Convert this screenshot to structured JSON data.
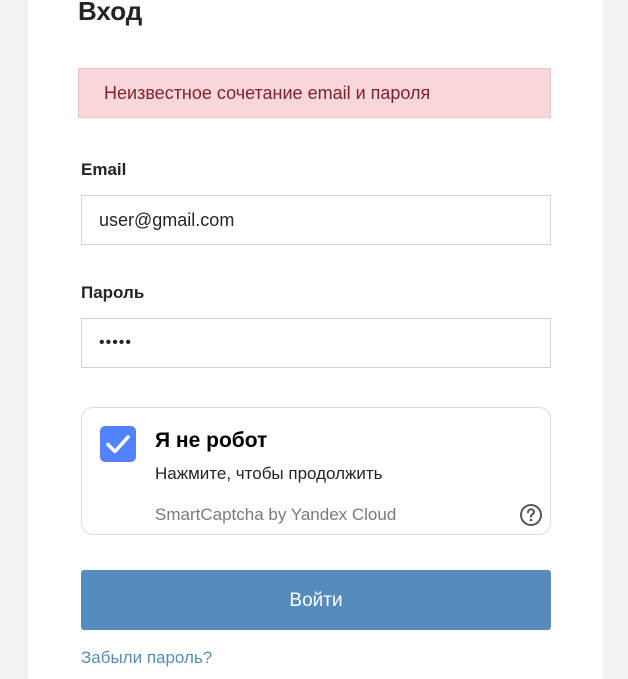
{
  "page": {
    "title": "Вход"
  },
  "alert": {
    "message": "Неизвестное сочетание email и пароля"
  },
  "form": {
    "email_label": "Email",
    "email_value": "user@gmail.com",
    "password_label": "Пароль",
    "password_value": "•••••",
    "submit_label": "Войти",
    "forgot_label": "Забыли пароль?"
  },
  "captcha": {
    "title": "Я не робот",
    "subtitle": "Нажмите, чтобы продолжить",
    "brand": "SmartCaptcha by Yandex Cloud",
    "checked": true,
    "checkbox_icon": "check-icon",
    "help_icon": "question-circle-icon"
  },
  "colors": {
    "accent": "#558cbd",
    "checkbox": "#5282ff",
    "alert_bg": "#f8d7da",
    "alert_text": "#842029"
  }
}
